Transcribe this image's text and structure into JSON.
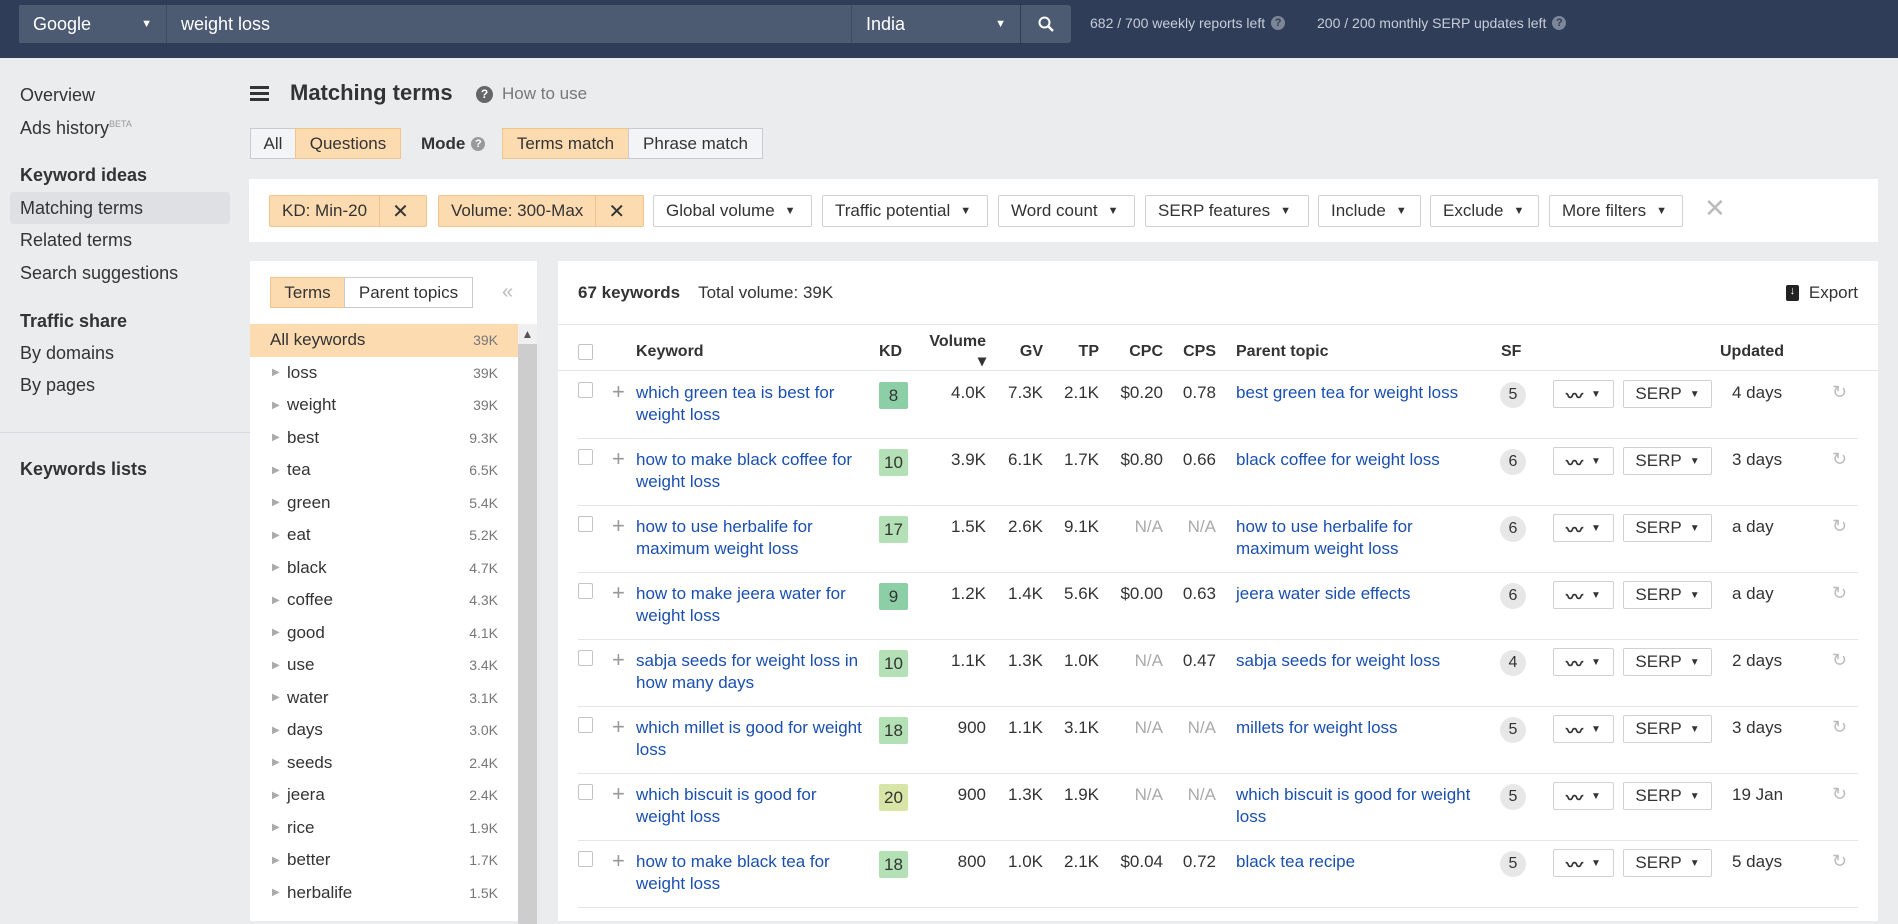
{
  "topbar": {
    "engine": "Google",
    "query": "weight loss",
    "country": "India",
    "reports": "682 / 700 weekly reports left",
    "serp_updates": "200 / 200 monthly SERP updates left",
    "help": "?"
  },
  "sidebar": {
    "overview": "Overview",
    "ads_history": "Ads history",
    "beta": "BETA",
    "keyword_ideas": "Keyword ideas",
    "matching_terms": "Matching terms",
    "related_terms": "Related terms",
    "search_suggestions": "Search suggestions",
    "traffic_share": "Traffic share",
    "by_domains": "By domains",
    "by_pages": "By pages",
    "keywords_lists": "Keywords lists"
  },
  "header": {
    "title": "Matching terms",
    "how_to_use": "How to use",
    "help": "?"
  },
  "toggles": {
    "all": "All",
    "questions": "Questions",
    "mode": "Mode",
    "terms_match": "Terms match",
    "phrase_match": "Phrase match",
    "active_type": "Questions",
    "active_mode": "Terms match"
  },
  "filters": {
    "kd": "KD: Min-20",
    "volume": "Volume: 300-Max",
    "close": "✕",
    "items": [
      "Global volume",
      "Traffic potential",
      "Word count",
      "SERP features",
      "Include",
      "Exclude",
      "More filters"
    ],
    "clear": "✕"
  },
  "left_panel": {
    "tab_terms": "Terms",
    "tab_parent": "Parent topics",
    "collapse": "«",
    "items": [
      {
        "term": "All keywords",
        "volume": "39K"
      },
      {
        "term": "loss",
        "volume": "39K"
      },
      {
        "term": "weight",
        "volume": "39K"
      },
      {
        "term": "best",
        "volume": "9.3K"
      },
      {
        "term": "tea",
        "volume": "6.5K"
      },
      {
        "term": "green",
        "volume": "5.4K"
      },
      {
        "term": "eat",
        "volume": "5.2K"
      },
      {
        "term": "black",
        "volume": "4.7K"
      },
      {
        "term": "coffee",
        "volume": "4.3K"
      },
      {
        "term": "good",
        "volume": "4.1K"
      },
      {
        "term": "use",
        "volume": "3.4K"
      },
      {
        "term": "water",
        "volume": "3.1K"
      },
      {
        "term": "days",
        "volume": "3.0K"
      },
      {
        "term": "seeds",
        "volume": "2.4K"
      },
      {
        "term": "jeera",
        "volume": "2.4K"
      },
      {
        "term": "rice",
        "volume": "1.9K"
      },
      {
        "term": "better",
        "volume": "1.7K"
      },
      {
        "term": "herbalife",
        "volume": "1.5K"
      }
    ]
  },
  "results": {
    "count": "67 keywords",
    "total_volume": "Total volume: 39K",
    "export": "Export",
    "columns": {
      "keyword": "Keyword",
      "kd": "KD",
      "volume": "Volume ▾",
      "gv": "GV",
      "tp": "TP",
      "cpc": "CPC",
      "cps": "CPS",
      "parent_topic": "Parent topic",
      "sf": "SF",
      "updated": "Updated"
    },
    "serp_label": "SERP",
    "kd_colors": {
      "easy": "#8ccfa6",
      "low": "#b3e0b5",
      "medium": "#d7e6a7"
    },
    "rows": [
      {
        "keyword": "which green tea is best for weight loss",
        "kd": "8",
        "volume": "4.0K",
        "gv": "7.3K",
        "tp": "2.1K",
        "cpc": "$0.20",
        "cps": "0.78",
        "parent": "best green tea for weight loss",
        "sf": "5",
        "updated": "4 days"
      },
      {
        "keyword": "how to make black coffee for weight loss",
        "kd": "10",
        "volume": "3.9K",
        "gv": "6.1K",
        "tp": "1.7K",
        "cpc": "$0.80",
        "cps": "0.66",
        "parent": "black coffee for weight loss",
        "sf": "6",
        "updated": "3 days"
      },
      {
        "keyword": "how to use herbalife for maximum weight loss",
        "kd": "17",
        "volume": "1.5K",
        "gv": "2.6K",
        "tp": "9.1K",
        "cpc": "N/A",
        "cps": "N/A",
        "parent": "how to use herbalife for maximum weight loss",
        "sf": "6",
        "updated": "a day"
      },
      {
        "keyword": "how to make jeera water for weight loss",
        "kd": "9",
        "volume": "1.2K",
        "gv": "1.4K",
        "tp": "5.6K",
        "cpc": "$0.00",
        "cps": "0.63",
        "parent": "jeera water side effects",
        "sf": "6",
        "updated": "a day"
      },
      {
        "keyword": "sabja seeds for weight loss in how many days",
        "kd": "10",
        "volume": "1.1K",
        "gv": "1.3K",
        "tp": "1.0K",
        "cpc": "N/A",
        "cps": "0.47",
        "parent": "sabja seeds for weight loss",
        "sf": "4",
        "updated": "2 days"
      },
      {
        "keyword": "which millet is good for weight loss",
        "kd": "18",
        "volume": "900",
        "gv": "1.1K",
        "tp": "3.1K",
        "cpc": "N/A",
        "cps": "N/A",
        "parent": "millets for weight loss",
        "sf": "5",
        "updated": "3 days"
      },
      {
        "keyword": "which biscuit is good for weight loss",
        "kd": "20",
        "volume": "900",
        "gv": "1.3K",
        "tp": "1.9K",
        "cpc": "N/A",
        "cps": "N/A",
        "parent": "which biscuit is good for weight loss",
        "sf": "5",
        "updated": "19 Jan"
      },
      {
        "keyword": "how to make black tea for weight loss",
        "kd": "18",
        "volume": "800",
        "gv": "1.0K",
        "tp": "2.1K",
        "cpc": "$0.04",
        "cps": "0.72",
        "parent": "black tea recipe",
        "sf": "5",
        "updated": "5 days"
      }
    ]
  }
}
